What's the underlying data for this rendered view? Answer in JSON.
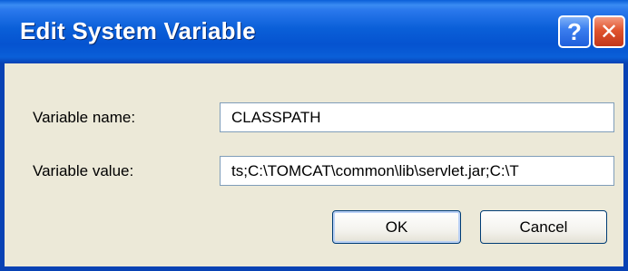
{
  "window": {
    "title": "Edit System Variable",
    "help_glyph": "?",
    "close_glyph": "✕"
  },
  "form": {
    "name_label": "Variable name:",
    "name_value": "CLASSPATH",
    "value_label": "Variable value:",
    "value_value": "ts;C:\\TOMCAT\\common\\lib\\servlet.jar;C:\\T"
  },
  "buttons": {
    "ok_label": "OK",
    "cancel_label": "Cancel"
  },
  "icons": {
    "help": "help-icon",
    "close": "close-icon"
  },
  "colors": {
    "titlebar": "#0a5fd8",
    "dialog_bg": "#ece9d8",
    "close_button": "#e0542e"
  }
}
